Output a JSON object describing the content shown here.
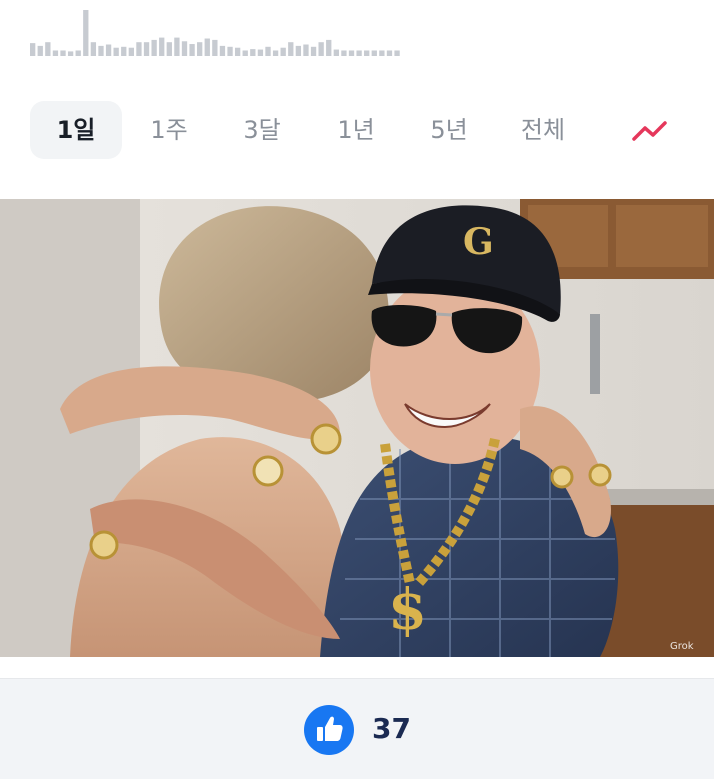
{
  "period_tabs": [
    {
      "label": "1일",
      "active": true
    },
    {
      "label": "1주",
      "active": false
    },
    {
      "label": "3달",
      "active": false
    },
    {
      "label": "1년",
      "active": false
    },
    {
      "label": "5년",
      "active": false
    },
    {
      "label": "전체",
      "active": false
    }
  ],
  "trend_toggle": {
    "icon": "trend-line-icon",
    "color": "#e5375b"
  },
  "mini_chart": {
    "color": "#c7cbd1",
    "values": [
      0.28,
      0.22,
      0.3,
      0.12,
      0.12,
      0.1,
      0.12,
      1.0,
      0.3,
      0.22,
      0.25,
      0.18,
      0.2,
      0.18,
      0.3,
      0.3,
      0.35,
      0.4,
      0.3,
      0.4,
      0.32,
      0.26,
      0.3,
      0.38,
      0.35,
      0.22,
      0.2,
      0.18,
      0.12,
      0.15,
      0.14,
      0.2,
      0.12,
      0.18,
      0.3,
      0.22,
      0.25,
      0.2,
      0.3,
      0.35,
      0.14,
      0.12,
      0.12,
      0.12,
      0.12,
      0.12,
      0.12,
      0.12,
      0.12
    ]
  },
  "photo": {
    "watermark": "Grok"
  },
  "reaction": {
    "icon": "thumbs-up-icon",
    "count": "37",
    "accent": "#1877f2"
  }
}
